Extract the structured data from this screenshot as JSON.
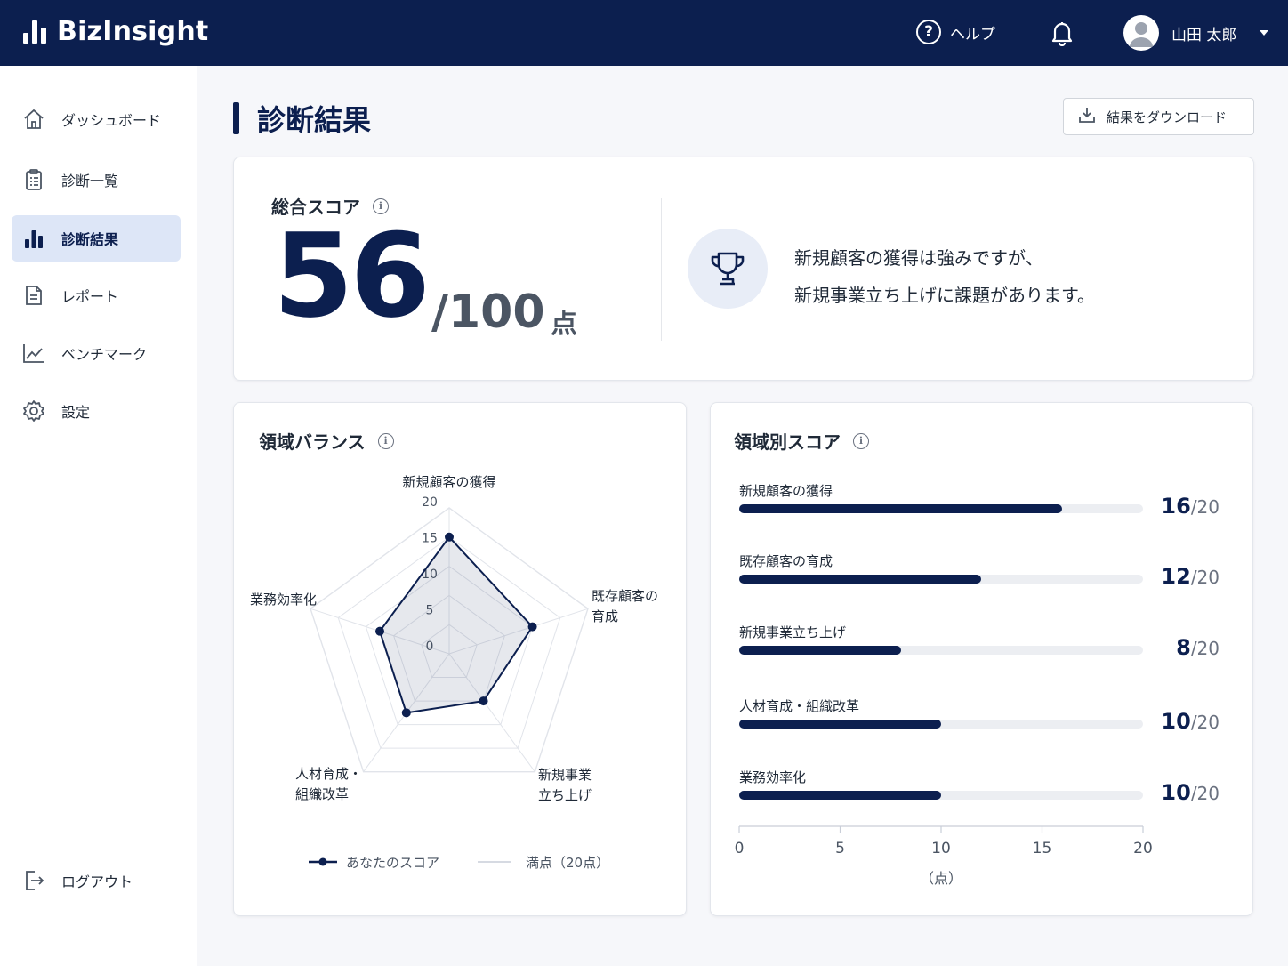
{
  "header": {
    "brand": "BizInsight",
    "help_label": "ヘルプ",
    "user_name": "山田 太郎"
  },
  "sidebar": {
    "items": [
      {
        "label": "ダッシュボード",
        "icon": "home-icon"
      },
      {
        "label": "診断一覧",
        "icon": "clipboard-icon"
      },
      {
        "label": "診断結果",
        "icon": "bar-chart-icon",
        "active": true
      },
      {
        "label": "レポート",
        "icon": "document-icon"
      },
      {
        "label": "ベンチマーク",
        "icon": "trend-icon"
      },
      {
        "label": "設定",
        "icon": "gear-icon"
      }
    ],
    "logout_label": "ログアウト"
  },
  "page": {
    "title": "診断結果",
    "download_label": "結果をダウンロード"
  },
  "score_card": {
    "label": "総合スコア",
    "score": "56",
    "max": "/100",
    "unit": "点",
    "summary_line1": "新規顧客の獲得は強みですが、",
    "summary_line2": "新規事業立ち上げに課題があります。"
  },
  "radar_card": {
    "title": "領域バランス",
    "legend_you": "あなたのスコア",
    "legend_full": "満点（20点）"
  },
  "bars_card": {
    "title": "領域別スコア",
    "axis_unit": "（点）"
  },
  "chart_data": [
    {
      "type": "radar",
      "title": "",
      "axes": [
        "新規顧客の獲得",
        "既存顧客の育成",
        "新規事業立ち上げ",
        "人材育成・組織改革",
        "業務効率化"
      ],
      "axis_label_lines": [
        [
          "新規顧客の獲得"
        ],
        [
          "既存顧客の",
          "育成"
        ],
        [
          "新規事業",
          "立ち上げ"
        ],
        [
          "人材育成・",
          "組織改革"
        ],
        [
          "業務効率化"
        ]
      ],
      "ticks": [
        "0",
        "5",
        "10",
        "15",
        "20"
      ],
      "range": [
        0,
        20
      ],
      "series": [
        {
          "name": "あなたのスコア",
          "values": [
            16,
            12,
            8,
            10,
            10
          ]
        },
        {
          "name": "満点（20点）",
          "values": [
            20,
            20,
            20,
            20,
            20
          ]
        }
      ],
      "colors": {
        "you": "#0c1f4f",
        "full": "#d1d5db"
      }
    },
    {
      "type": "bar",
      "orientation": "horizontal",
      "categories": [
        "新規顧客の獲得",
        "既存顧客の育成",
        "新規事業立ち上げ",
        "人材育成・組織改革",
        "業務効率化"
      ],
      "values": [
        16,
        12,
        8,
        10,
        10
      ],
      "max_label": "/20",
      "xlim": [
        0,
        20
      ],
      "x_ticks": [
        "0",
        "5",
        "10",
        "15",
        "20"
      ],
      "xlabel": "（点）",
      "color": "#0c1f4f"
    }
  ]
}
